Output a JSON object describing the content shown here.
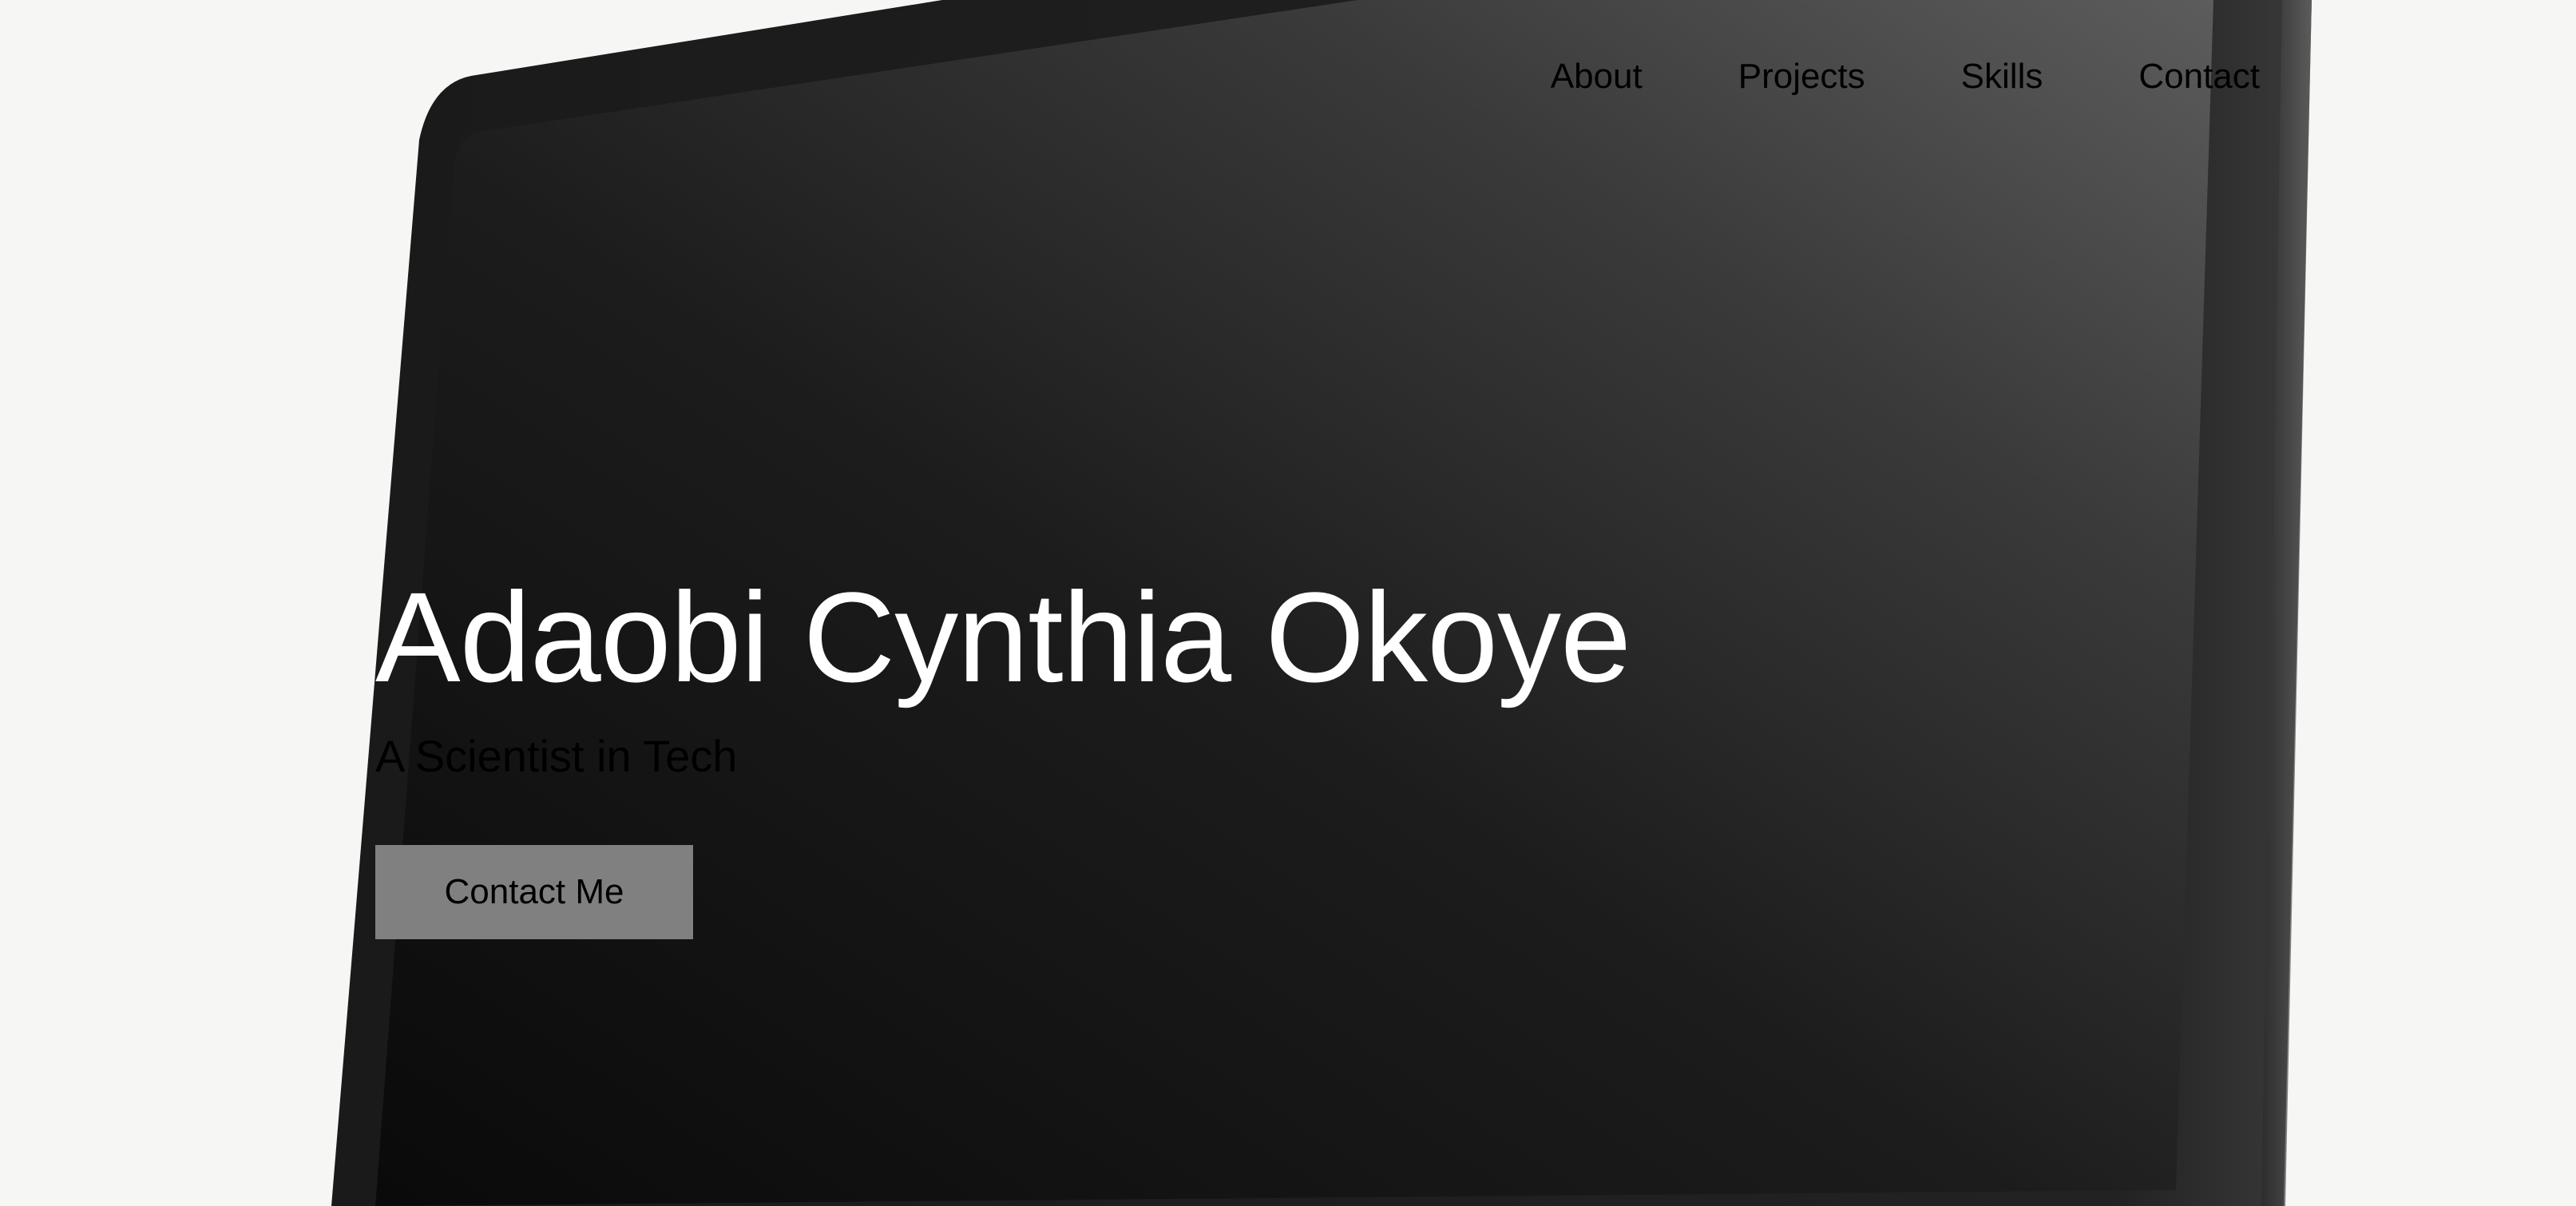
{
  "nav": {
    "items": [
      {
        "label": "About"
      },
      {
        "label": "Projects"
      },
      {
        "label": "Skills"
      },
      {
        "label": "Contact"
      }
    ]
  },
  "hero": {
    "title": "Adaobi Cynthia Okoye",
    "subtitle": "A Scientist in Tech",
    "cta_label": "Contact Me"
  },
  "colors": {
    "background": "#f6f6f4",
    "screen_dark": "#141414",
    "screen_light": "#5a5a5a",
    "bezel": "#1e1e1e",
    "title_text": "#ffffff",
    "body_text": "#000000",
    "button_bg": "#808080"
  }
}
